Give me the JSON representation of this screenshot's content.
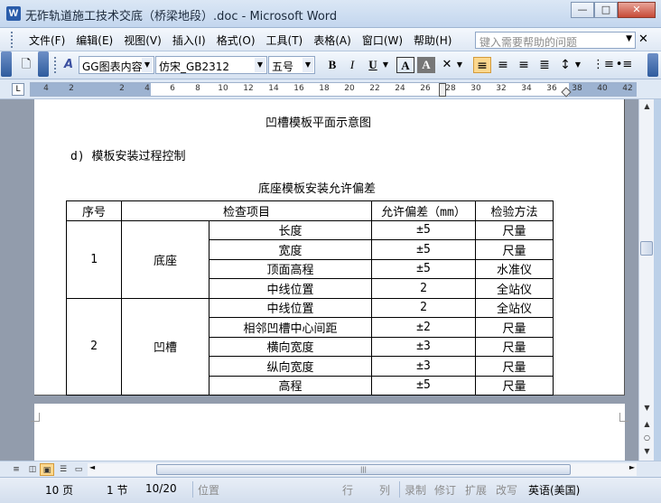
{
  "window": {
    "title": "无砟轨道施工技术交底（桥梁地段）.doc - Microsoft Word",
    "app_icon": "W",
    "minimize": "—",
    "maximize": "□",
    "close": "✕"
  },
  "menubar": {
    "items": [
      "文件(F)",
      "编辑(E)",
      "视图(V)",
      "插入(I)",
      "格式(O)",
      "工具(T)",
      "表格(A)",
      "窗口(W)",
      "帮助(H)"
    ],
    "help_placeholder": "键入需要帮助的问题",
    "close": "✕"
  },
  "toolbar": {
    "style": "GG图表内容",
    "font": "仿宋_GB2312",
    "size": "五号",
    "bold": "B",
    "italic": "I",
    "underline": "U",
    "border_a": "A",
    "shade_a": "A"
  },
  "ruler": {
    "tab_selector": "L",
    "labels": [
      "4",
      "2",
      "",
      "2",
      "4",
      "6",
      "8",
      "10",
      "12",
      "14",
      "16",
      "18",
      "20",
      "22",
      "24",
      "26",
      "28",
      "30",
      "32",
      "34",
      "36",
      "38",
      "40",
      "42"
    ]
  },
  "document": {
    "figure_caption": "凹槽模板平面示意图",
    "section_heading": "d) 模板安装过程控制",
    "table_title": "底座模板安装允许偏差",
    "table": {
      "headers": [
        "序号",
        "检查项目",
        "允许偏差（mm）",
        "检验方法"
      ],
      "group1": {
        "no": "1",
        "name": "底座",
        "rows": [
          {
            "item": "长度",
            "tol": "±5",
            "method": "尺量"
          },
          {
            "item": "宽度",
            "tol": "±5",
            "method": "尺量"
          },
          {
            "item": "顶面高程",
            "tol": "±5",
            "method": "水准仪"
          },
          {
            "item": "中线位置",
            "tol": "2",
            "method": "全站仪"
          }
        ]
      },
      "group2": {
        "no": "2",
        "name": "凹槽",
        "rows": [
          {
            "item": "中线位置",
            "tol": "2",
            "method": "全站仪"
          },
          {
            "item": "相邻凹槽中心间距",
            "tol": "±2",
            "method": "尺量"
          },
          {
            "item": "横向宽度",
            "tol": "±3",
            "method": "尺量"
          },
          {
            "item": "纵向宽度",
            "tol": "±3",
            "method": "尺量"
          },
          {
            "item": "高程",
            "tol": "±5",
            "method": "尺量"
          }
        ]
      }
    }
  },
  "statusbar": {
    "page": "10 页",
    "section": "1 节",
    "page_of": "10/20",
    "position": "位置",
    "line": "行",
    "column": "列",
    "rec": "录制",
    "trk": "修订",
    "ext": "扩展",
    "ovr": "改写",
    "language": "英语(美国)"
  },
  "colors": {
    "titlebar": "#c3d6ee",
    "toolbar": "#dfe8f4",
    "doc_background": "#929cac",
    "active_button": "#fcd88e"
  }
}
